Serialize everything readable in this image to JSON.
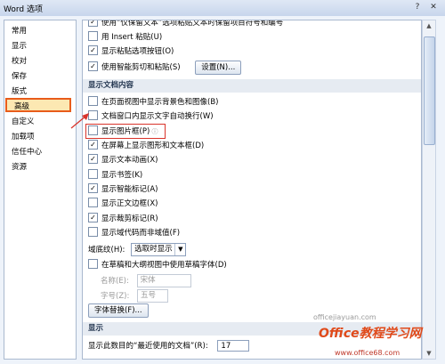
{
  "window": {
    "title": "Word 选项",
    "help": "?",
    "close": "✕"
  },
  "nav": {
    "items": [
      {
        "label": "常用",
        "selected": false
      },
      {
        "label": "显示",
        "selected": false
      },
      {
        "label": "校对",
        "selected": false
      },
      {
        "label": "保存",
        "selected": false
      },
      {
        "label": "版式",
        "selected": false
      },
      {
        "label": "高级",
        "selected": true
      },
      {
        "label": "自定义",
        "selected": false
      },
      {
        "label": "加载项",
        "selected": false
      },
      {
        "label": "信任中心",
        "selected": false
      },
      {
        "label": "资源",
        "selected": false
      }
    ]
  },
  "paste_options": [
    {
      "label": "使用“仅保留文本”选项粘贴文本时保留项目符号和编号",
      "checked": true
    },
    {
      "label": "用 Insert 粘贴(U)",
      "checked": false
    },
    {
      "label": "显示粘贴选项按钮(O)",
      "checked": true
    },
    {
      "label": "使用智能剪切和粘贴(S)",
      "checked": true
    }
  ],
  "settings_button": "设置(N)...",
  "section_display_content": "显示文档内容",
  "display_options": [
    {
      "label": "在页面视图中显示背景色和图像(B)",
      "checked": false
    },
    {
      "label": "文档窗口内显示文字自动换行(W)",
      "checked": false
    },
    {
      "label": "显示图片框(P)",
      "checked": false
    },
    {
      "label": "在屏幕上显示图形和文本框(D)",
      "checked": true
    },
    {
      "label": "显示文本动画(X)",
      "checked": true
    },
    {
      "label": "显示书签(K)",
      "checked": false
    },
    {
      "label": "显示智能标记(A)",
      "checked": true
    },
    {
      "label": "显示正文边框(X)",
      "checked": false
    },
    {
      "label": "显示裁剪标记(R)",
      "checked": true
    },
    {
      "label": "显示域代码而非域值(F)",
      "checked": false
    }
  ],
  "field_shading": {
    "label": "域底纹(H):",
    "value": "选取时显示"
  },
  "draft_font": {
    "label": "在草稿和大纲视图中使用草稿字体(D)",
    "checked": false
  },
  "font_name": {
    "label": "名称(E):",
    "value": "宋体"
  },
  "font_size": {
    "label": "字号(Z):",
    "value": "五号"
  },
  "font_substitution_button": "字体替换(F)...",
  "section_display": "显示",
  "recent_docs": {
    "label": "显示此数目的“最近使用的文档”(R):",
    "value": "17"
  },
  "watermark": {
    "site": "officejiayuan.com",
    "brand": "Office教程学习网",
    "url": "www.office68.com"
  },
  "colors": {
    "highlight_border": "#d9342b",
    "selected_nav_border": "#e85c1a",
    "arrow": "#d9342b"
  }
}
